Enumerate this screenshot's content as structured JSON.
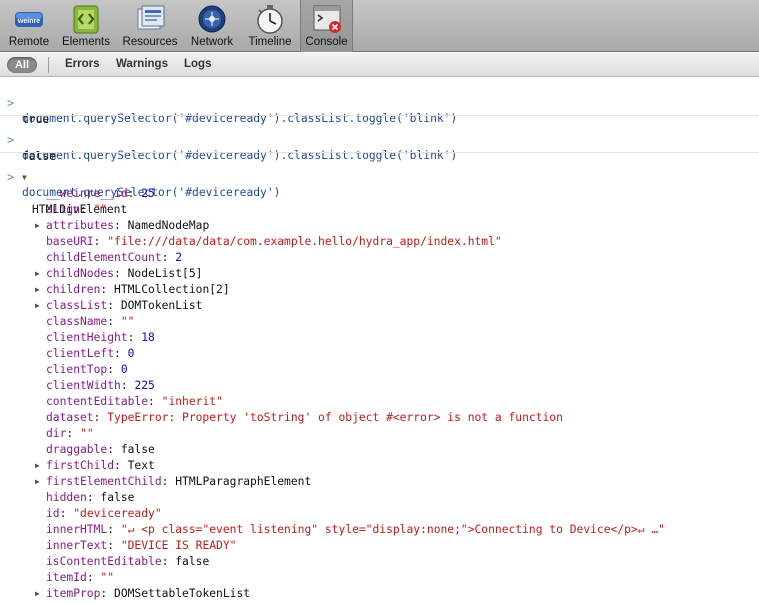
{
  "toolbar": {
    "buttons": [
      {
        "label": "Remote",
        "icon": "weinre-logo-icon",
        "badge": "weinre"
      },
      {
        "label": "Elements",
        "icon": "elements-icon"
      },
      {
        "label": "Resources",
        "icon": "resources-icon"
      },
      {
        "label": "Network",
        "icon": "network-icon"
      },
      {
        "label": "Timeline",
        "icon": "timeline-icon"
      },
      {
        "label": "Console",
        "icon": "console-icon",
        "active": true
      }
    ]
  },
  "filter": {
    "all": "All",
    "errors": "Errors",
    "warnings": "Warnings",
    "logs": "Logs"
  },
  "console": {
    "entries": [
      {
        "command": "document.querySelector('#deviceready').classList.toggle('blink')",
        "result": "true"
      },
      {
        "command": "document.querySelector('#deviceready').classList.toggle('blink')",
        "result": "false"
      },
      {
        "command": "document.querySelector('#deviceready')",
        "result": "HTMLDivElement"
      }
    ],
    "properties": [
      {
        "key": "__weinre__id",
        "value": "25",
        "kind": "num",
        "expandable": false
      },
      {
        "key": "align",
        "value": "\"\"",
        "kind": "str",
        "expandable": false
      },
      {
        "key": "attributes",
        "value": "NamedNodeMap",
        "kind": "obj",
        "expandable": true
      },
      {
        "key": "baseURI",
        "value": "\"file:///data/data/com.example.hello/hydra_app/index.html\"",
        "kind": "str",
        "expandable": false
      },
      {
        "key": "childElementCount",
        "value": "2",
        "kind": "num",
        "expandable": false
      },
      {
        "key": "childNodes",
        "value": "NodeList[5]",
        "kind": "obj",
        "expandable": true
      },
      {
        "key": "children",
        "value": "HTMLCollection[2]",
        "kind": "obj",
        "expandable": true
      },
      {
        "key": "classList",
        "value": "DOMTokenList",
        "kind": "obj",
        "expandable": true
      },
      {
        "key": "className",
        "value": "\"\"",
        "kind": "str",
        "expandable": false
      },
      {
        "key": "clientHeight",
        "value": "18",
        "kind": "num",
        "expandable": false
      },
      {
        "key": "clientLeft",
        "value": "0",
        "kind": "num",
        "expandable": false
      },
      {
        "key": "clientTop",
        "value": "0",
        "kind": "num",
        "expandable": false
      },
      {
        "key": "clientWidth",
        "value": "225",
        "kind": "num",
        "expandable": false
      },
      {
        "key": "contentEditable",
        "value": "\"inherit\"",
        "kind": "str",
        "expandable": false
      },
      {
        "key": "dataset",
        "value": "TypeError: Property 'toString' of object #<error> is not a function",
        "kind": "str",
        "expandable": false
      },
      {
        "key": "dir",
        "value": "\"\"",
        "kind": "str",
        "expandable": false
      },
      {
        "key": "draggable",
        "value": "false",
        "kind": "obj",
        "expandable": false
      },
      {
        "key": "firstChild",
        "value": "Text",
        "kind": "obj",
        "expandable": true
      },
      {
        "key": "firstElementChild",
        "value": "HTMLParagraphElement",
        "kind": "obj",
        "expandable": true
      },
      {
        "key": "hidden",
        "value": "false",
        "kind": "obj",
        "expandable": false
      },
      {
        "key": "id",
        "value": "\"deviceready\"",
        "kind": "str",
        "expandable": false
      },
      {
        "key": "innerHTML",
        "value": "\"↵ <p class=\"event listening\" style=\"display:none;\">Connecting to Device</p>↵ …\"",
        "kind": "str",
        "expandable": false
      },
      {
        "key": "innerText",
        "value": "\"DEVICE IS READY\"",
        "kind": "str",
        "expandable": false
      },
      {
        "key": "isContentEditable",
        "value": "false",
        "kind": "obj",
        "expandable": false
      },
      {
        "key": "itemId",
        "value": "\"\"",
        "kind": "str",
        "expandable": false
      },
      {
        "key": "itemProp",
        "value": "DOMSettableTokenList",
        "kind": "obj",
        "expandable": true
      }
    ]
  }
}
